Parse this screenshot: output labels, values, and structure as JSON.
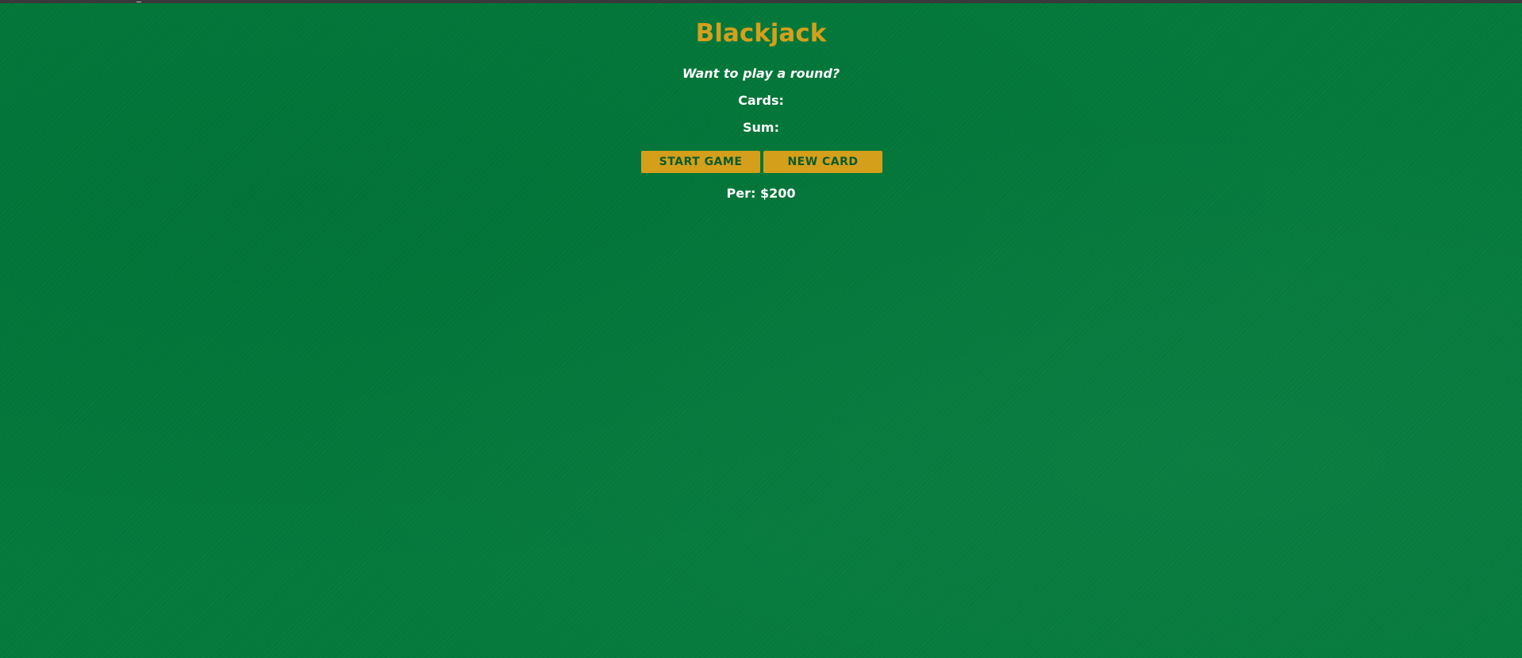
{
  "game": {
    "title": "Blackjack",
    "message": "Want to play a round?",
    "cards_label": "Cards:",
    "sum_label": "Sum:",
    "player_text": "Per: $200"
  },
  "buttons": {
    "start_label": "START GAME",
    "new_card_label": "NEW CARD"
  },
  "colors": {
    "felt": "#037a3b",
    "accent": "#d4a01c",
    "button_text": "#0b5a2a",
    "text": "#ffffff"
  }
}
